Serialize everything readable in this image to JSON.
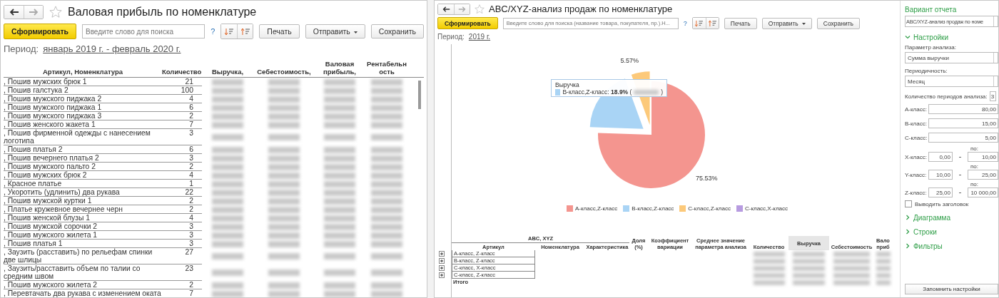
{
  "gross_profit_window": {
    "title": "Валовая прибыль по номенклатуре",
    "generate_button": "Сформировать",
    "search": {
      "placeholder": "Введите слово для поиска"
    },
    "help": "?",
    "buttons": [
      {
        "label": "Печать",
        "kind": "plain"
      },
      {
        "label": "Отправить",
        "kind": "dropdown"
      },
      {
        "label": "Сохранить",
        "kind": "plain"
      }
    ],
    "period_label": "Период:",
    "period_value": "январь 2019 г. - февраль 2020 г.",
    "table": {
      "columns": [
        {
          "lines": [
            "Артикул, Номенклатура"
          ],
          "kind": "name"
        },
        {
          "lines": [
            "Количество"
          ],
          "kind": "number"
        },
        {
          "lines": [
            "Выручка,"
          ],
          "kind": "blurred"
        },
        {
          "lines": [
            "Себестоимость,"
          ],
          "kind": "blurred"
        },
        {
          "lines": [
            "Валовая",
            "прибыль,"
          ],
          "kind": "blurred"
        },
        {
          "lines": [
            "Рентабельн",
            "ость"
          ],
          "kind": "blurred"
        }
      ],
      "rows": [
        {
          "name": ", Пошив мужских брюк 1",
          "quantity": "21"
        },
        {
          "name": ", Пошив галстука 2",
          "quantity": "100"
        },
        {
          "name": ", Пошив мужского пиджака 2",
          "quantity": "4"
        },
        {
          "name": ", Пошив мужского пиджака 1",
          "quantity": "6"
        },
        {
          "name": ", Пошив мужского пиджака 3",
          "quantity": "2"
        },
        {
          "name": ", Пошив женского жакета 1",
          "quantity": "7"
        },
        {
          "name": ", Пошив фирменной одежды с нанесением логотипа",
          "quantity": "3"
        },
        {
          "name": ", Пошив платья 2",
          "quantity": "6"
        },
        {
          "name": ", Пошив вечернего платья 2",
          "quantity": "3"
        },
        {
          "name": ", Пошив мужского пальто 2",
          "quantity": "2"
        },
        {
          "name": ", Пошив мужских брюк 2",
          "quantity": "4"
        },
        {
          "name": ", Красное платье",
          "quantity": "1"
        },
        {
          "name": ", Укоротить (удлинить) два рукава",
          "quantity": "22"
        },
        {
          "name": ", Пошив мужской куртки 1",
          "quantity": "2"
        },
        {
          "name": ", Платье кружевное вечернее черн",
          "quantity": "2"
        },
        {
          "name": ", Пошив женской блузы 1",
          "quantity": "4"
        },
        {
          "name": ", Пошив мужской сорочки 2",
          "quantity": "3"
        },
        {
          "name": ", Пошив мужского жилета 1",
          "quantity": "3"
        },
        {
          "name": ", Пошив платья 1",
          "quantity": "3"
        },
        {
          "name": ", Заузить (расставить) по рельефам спинки две шлицы",
          "quantity": "27"
        },
        {
          "name": ", Заузить/расставить объем по талии со средним швом",
          "quantity": "23"
        },
        {
          "name": ", Пошив мужского жилета 2",
          "quantity": "2"
        },
        {
          "name": ", Перевтачать два рукава с изменением оката",
          "quantity": "7"
        }
      ]
    }
  },
  "abc_window": {
    "title": "ABC/XYZ-анализ продаж по номенклатуре",
    "generate_button": "Сформировать",
    "search": {
      "placeholder": "Введите слово для поиска (название товара, покупателя, пр.).Н..."
    },
    "help": "?",
    "buttons": [
      {
        "label": "Печать",
        "kind": "plain"
      },
      {
        "label": "Отправить",
        "kind": "dropdown"
      },
      {
        "label": "Сохранить",
        "kind": "plain"
      }
    ],
    "period_label": "Период:",
    "period_value": "2019 г.",
    "chart_data": {
      "type": "pie",
      "categories": [
        "A-класс,Z-класс",
        "B-класс,Z-класс",
        "C-класс,Z-класс",
        "C-класс,X-класс"
      ],
      "colors": [
        "#f4958f",
        "#a9d4f5",
        "#fcc97a",
        "#b79be0"
      ],
      "series": [
        {
          "name": "Выручка",
          "values": [
            75.53,
            18.9,
            5.57,
            0
          ]
        }
      ],
      "value_labels": [
        "75.53%",
        null,
        "5.57%",
        null
      ],
      "legend": "bottom"
    },
    "tooltip": {
      "text": "B-класс,Z-класс: **18.9%** (",
      "text_end": ")",
      "color": "#a9d4f5"
    },
    "table": {
      "group_header": "ABC, XYZ",
      "columns": [
        {
          "lines": [
            "Артикул"
          ],
          "kind": "group"
        },
        {
          "lines": [
            "Номенклатура"
          ],
          "kind": "group"
        },
        {
          "lines": [
            "Характеристика"
          ],
          "kind": "group"
        },
        {
          "lines": [
            "Доля",
            "(%)"
          ],
          "kind": "plain"
        },
        {
          "lines": [
            "Коэффициент",
            "вариации"
          ],
          "kind": "plain"
        },
        {
          "lines": [
            "Среднее значение",
            "параметра анализа"
          ],
          "kind": "plain"
        },
        {
          "lines": [
            "Количество"
          ],
          "kind": "blurred"
        },
        {
          "lines": [
            "Выручка"
          ],
          "kind": "sorted"
        },
        {
          "lines": [
            "Себестоимость"
          ],
          "kind": "blurred"
        },
        {
          "lines": [
            "Вало",
            "приб"
          ],
          "kind": "blurred"
        }
      ],
      "rows": [
        {
          "label": "A-класс, Z-класс",
          "kind": "group"
        },
        {
          "label": "B-класс, Z-класс",
          "kind": "group"
        },
        {
          "label": "C-класс, X-класс",
          "kind": "group"
        },
        {
          "label": "C-класс, Z-класс",
          "kind": "group"
        },
        {
          "label": "Итого",
          "kind": "total"
        }
      ]
    }
  },
  "settings_panel": {
    "variant_title": "Вариант отчета",
    "variant_value": "ABC/XYZ-анализ продаж по номе",
    "sections": [
      {
        "title": "Настройки",
        "expanded": true
      },
      {
        "title": "Диаграмма",
        "expanded": false
      },
      {
        "title": "Строки",
        "expanded": false
      },
      {
        "title": "Фильтры",
        "expanded": false
      }
    ],
    "settings": {
      "selects": [
        {
          "label": "Параметр анализа:",
          "value": "Сумма выручки"
        },
        {
          "label": "Периодичность:",
          "value": "Месяц"
        }
      ],
      "period_count": {
        "label": "Количество периодов анализа:",
        "value": "3"
      },
      "classes": [
        {
          "label": "A-класс:",
          "value": "80,00"
        },
        {
          "label": "B-класс:",
          "value": "15,00"
        },
        {
          "label": "C-класс:",
          "value": "5,00"
        }
      ],
      "ranges": [
        {
          "label": "X-класс:",
          "from": "0,00",
          "to_label": "по:",
          "to": "10,00"
        },
        {
          "label": "Y-класс:",
          "from": "10,00",
          "to_label": "по:",
          "to": "25,00"
        },
        {
          "label": "Z-класс:",
          "from": "25,00",
          "to_label": "по:",
          "to": "10 000,00"
        }
      ],
      "show_header": {
        "label": "Выводить заголовок",
        "checked": false
      }
    },
    "save_button": "Запомнить настройки"
  }
}
